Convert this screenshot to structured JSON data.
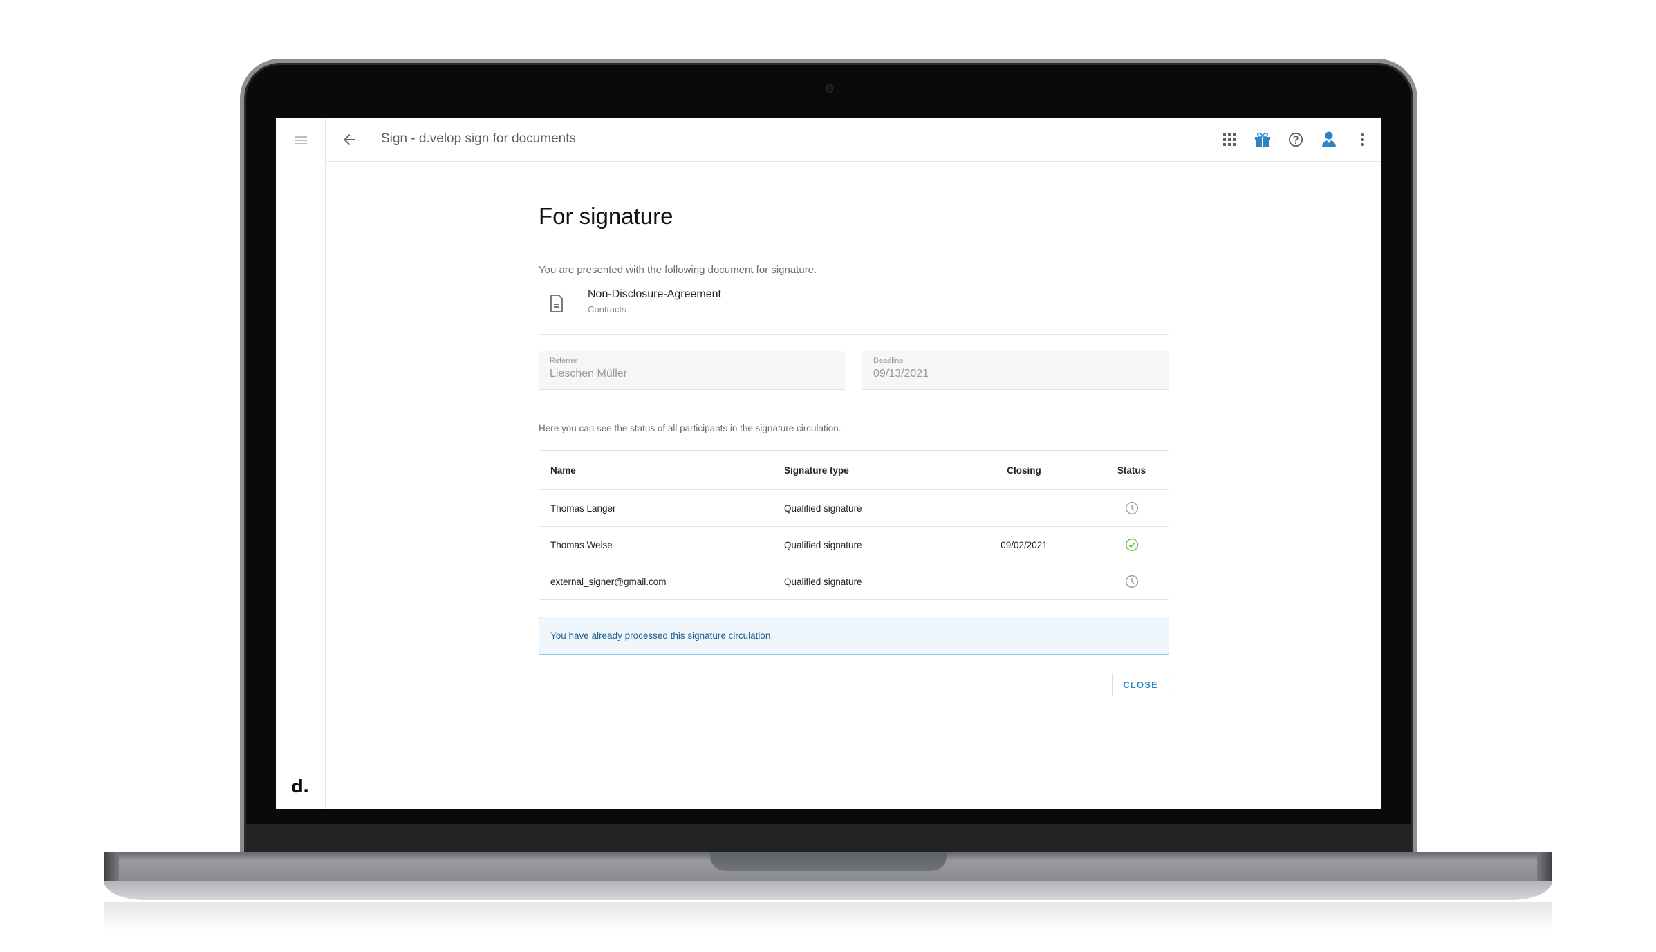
{
  "app": {
    "title": "Sign - d.velop sign for documents",
    "brand": "d."
  },
  "header": {
    "back_icon": "arrow-left-icon",
    "icons": [
      {
        "name": "apps-grid-icon",
        "color": "#616161"
      },
      {
        "name": "gift-icon",
        "color": "#2a86c4"
      },
      {
        "name": "help-icon",
        "color": "#616161"
      },
      {
        "name": "user-icon",
        "color": "#2a86c4"
      },
      {
        "name": "more-vertical-icon",
        "color": "#616161"
      }
    ]
  },
  "main": {
    "title": "For signature",
    "intro": "You are presented with the following document for signature.",
    "document": {
      "name": "Non-Disclosure-Agreement",
      "category": "Contracts",
      "icon": "document-icon"
    },
    "fields": {
      "referrer": {
        "label": "Referrer",
        "value": "Lieschen Müller"
      },
      "deadline": {
        "label": "Deadline",
        "value": "09/13/2021"
      }
    },
    "status_intro": "Here you can see the status of all participants in the signature circulation.",
    "table": {
      "columns": [
        "Name",
        "Signature type",
        "Closing",
        "Status"
      ],
      "rows": [
        {
          "name": "Thomas Langer",
          "type": "Qualified signature",
          "closing": "",
          "status": "pending",
          "status_icon": "clock-icon"
        },
        {
          "name": "Thomas Weise",
          "type": "Qualified signature",
          "closing": "09/02/2021",
          "status": "signed",
          "status_icon": "check-circle-icon"
        },
        {
          "name": "external_signer@gmail.com",
          "type": "Qualified signature",
          "closing": "",
          "status": "pending",
          "status_icon": "clock-icon"
        }
      ]
    },
    "info_message": "You have already processed this signature circulation.",
    "close_label": "CLOSE"
  },
  "colors": {
    "accent": "#2a86c4",
    "success": "#5cc83a",
    "pending": "#9e9e9e",
    "info_bg": "#eff7fd",
    "info_border": "#8cc8ef"
  }
}
